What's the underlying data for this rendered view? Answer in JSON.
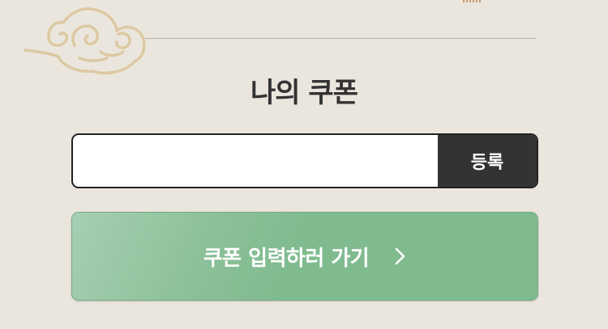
{
  "header": {
    "title": "나의 쿠폰"
  },
  "coupon_form": {
    "input_value": "",
    "input_placeholder": "",
    "register_label": "등록"
  },
  "actions": {
    "go_coupon_label": "쿠폰 입력하러 가기"
  },
  "icons": {
    "decoration": "cloud-icon",
    "chevron": "chevron-right-icon"
  },
  "colors": {
    "background": "#ebe6dd",
    "cloud": "#dcc9a3",
    "register_button": "#333333",
    "go_button": "#80bb90"
  }
}
